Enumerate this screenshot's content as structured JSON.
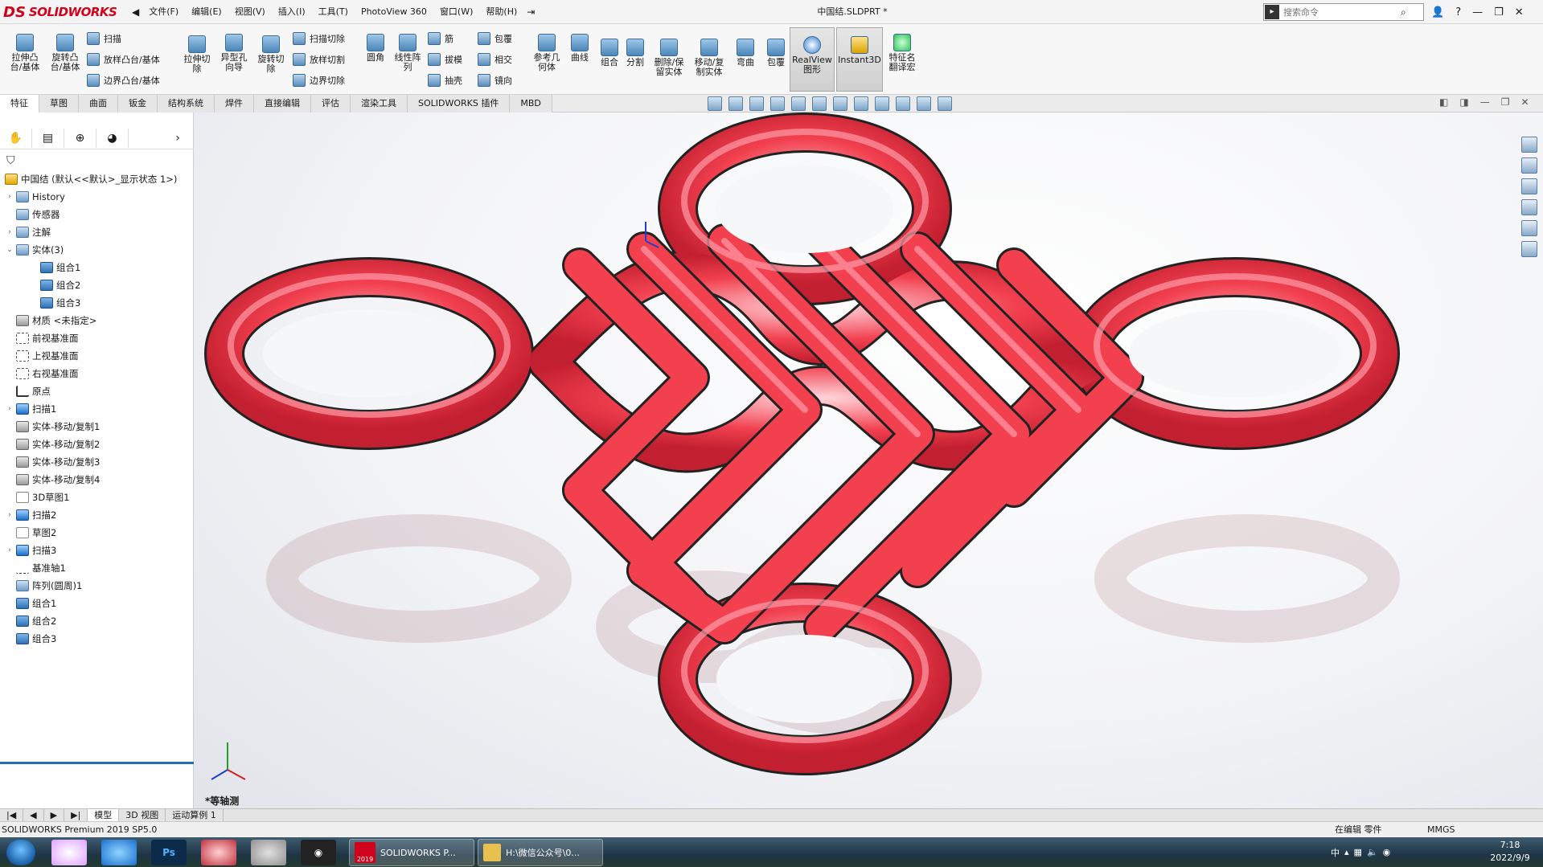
{
  "app": {
    "brand_prefix": "DS",
    "brand": "SOLIDWORKS"
  },
  "menu": {
    "items": [
      "文件(F)",
      "编辑(E)",
      "视图(V)",
      "插入(I)",
      "工具(T)",
      "PhotoView 360",
      "窗口(W)",
      "帮助(H)"
    ]
  },
  "document": {
    "title": "中国结.SLDPRT *"
  },
  "search": {
    "placeholder": "搜索命令"
  },
  "ribbon": {
    "extrude_boss": "拉伸凸台/基体",
    "revolve_boss": "旋转凸台/基体",
    "sweep": "扫描",
    "loft_boss": "放样凸台/基体",
    "boundary_boss": "边界凸台/基体",
    "extrude_cut": "拉伸切除",
    "hole_wizard": "异型孔向导",
    "revolve_cut": "旋转切除",
    "swept_cut": "扫描切除",
    "loft_cut": "放样切割",
    "boundary_cut": "边界切除",
    "fillet": "圆角",
    "linear_pattern": "线性阵列",
    "rib": "筋",
    "draft": "拔模",
    "shell": "抽壳",
    "wrap": "包覆",
    "intersect": "相交",
    "mirror": "镜向",
    "ref_geometry": "参考几何体",
    "curves": "曲线",
    "combine": "组合",
    "split": "分割",
    "delete_body": "删除/保留实体",
    "move_copy": "移动/复制实体",
    "flex": "弯曲",
    "wrap2": "包覆",
    "realview": "RealView图形",
    "instant3d": "Instant3D",
    "feature_translate": "特征名翻译宏"
  },
  "tabs": [
    "特征",
    "草图",
    "曲面",
    "钣金",
    "结构系统",
    "焊件",
    "直接编辑",
    "评估",
    "渲染工具",
    "SOLIDWORKS 插件",
    "MBD"
  ],
  "tree": {
    "root": "中国结 (默认<<默认>_显示状态 1>)",
    "items": [
      {
        "label": "History"
      },
      {
        "label": "传感器"
      },
      {
        "label": "注解"
      },
      {
        "label": "实体(3)"
      },
      {
        "label": "组合1"
      },
      {
        "label": "组合2"
      },
      {
        "label": "组合3"
      },
      {
        "label": "材质 <未指定>"
      },
      {
        "label": "前视基准面"
      },
      {
        "label": "上视基准面"
      },
      {
        "label": "右视基准面"
      },
      {
        "label": "原点"
      },
      {
        "label": "扫描1"
      },
      {
        "label": "实体-移动/复制1"
      },
      {
        "label": "实体-移动/复制2"
      },
      {
        "label": "实体-移动/复制3"
      },
      {
        "label": "实体-移动/复制4"
      },
      {
        "label": "3D草图1"
      },
      {
        "label": "扫描2"
      },
      {
        "label": "草图2"
      },
      {
        "label": "扫描3"
      },
      {
        "label": "基准轴1"
      },
      {
        "label": "阵列(圆周)1"
      },
      {
        "label": "组合1"
      },
      {
        "label": "组合2"
      },
      {
        "label": "组合3"
      }
    ]
  },
  "viewport": {
    "view_label": "*等轴测",
    "knot_color": "#f2404f"
  },
  "bottom_tabs": [
    "模型",
    "3D 视图",
    "运动算例 1"
  ],
  "status": {
    "left": "SOLIDWORKS Premium 2019 SP5.0",
    "mode": "在编辑 零件",
    "units": "MMGS"
  },
  "taskbar": {
    "windows": [
      "SOLIDWORKS P...",
      "H:\\微信公众号\\0..."
    ],
    "sw_badge": "2019",
    "time": "7:18",
    "date": "2022/9/9"
  }
}
